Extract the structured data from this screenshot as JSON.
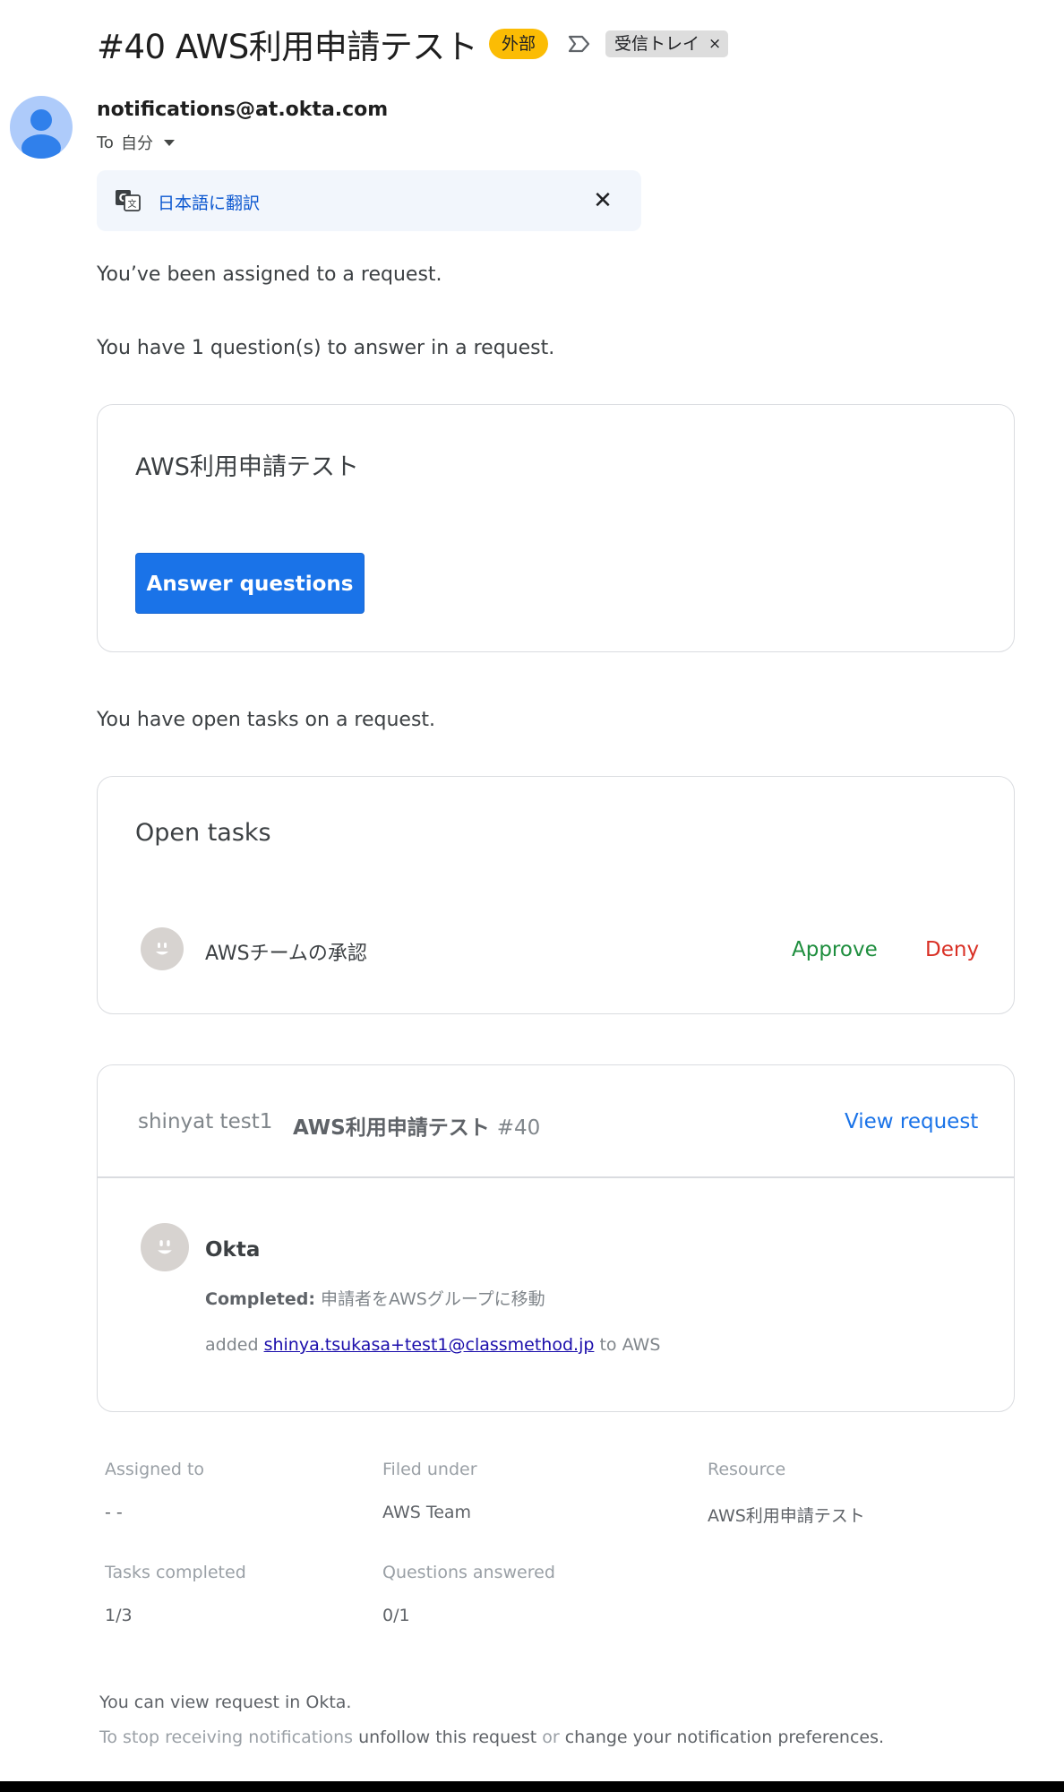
{
  "email": {
    "subject": "#40 AWS利用申請テスト",
    "external_badge": "外部",
    "inbox_label": "受信トレイ",
    "inbox_label_remove": "×",
    "sender": "notifications@at.okta.com",
    "to_prefix": "To",
    "to_value": "自分",
    "translate_link": "日本語に翻訳",
    "translate_close": "✕"
  },
  "body": {
    "assigned_text": "You’ve been assigned to a request.",
    "questions_text": "You have 1 question(s) to answer in a request.",
    "open_tasks_text": "You have open tasks on a request."
  },
  "question_card": {
    "title": "AWS利用申請テスト",
    "button_label": "Answer questions"
  },
  "tasks_card": {
    "title": "Open tasks",
    "task_name": "AWSチームの承認",
    "approve_label": "Approve",
    "deny_label": "Deny"
  },
  "request_card": {
    "requester": "shinyat test1",
    "request_title": "AWS利用申請テスト",
    "request_number": "#40",
    "view_label": "View request",
    "actor": "Okta",
    "completed_label": "Completed:",
    "completed_value": "申請者をAWSグループに移動",
    "added_prefix": "added",
    "added_email": "shinya.tsukasa+test1@classmethod.jp",
    "added_suffix": "to AWS"
  },
  "details": {
    "assigned_to_label": "Assigned to",
    "assigned_to_value": "- -",
    "filed_under_label": "Filed under",
    "filed_under_value": "AWS Team",
    "resource_label": "Resource",
    "resource_value": "AWS利用申請テスト",
    "tasks_completed_label": "Tasks completed",
    "tasks_completed_value": "1/3",
    "questions_answered_label": "Questions answered",
    "questions_answered_value": "0/1"
  },
  "footer": {
    "view_text": "You can view request in Okta.",
    "stop_prefix": "To stop receiving notifications",
    "unfollow_link": "unfollow this request",
    "or_text": "or",
    "preferences_link": "change your notification preferences."
  },
  "colors": {
    "external_badge": "#fbbc04",
    "primary_button": "#1a73e8",
    "approve": "#1e8e3e",
    "deny": "#d93025",
    "translate_bar": "#f2f6fc"
  },
  "icons": [
    "label-arrow-icon",
    "person-avatar-icon",
    "translate-icon",
    "close-icon",
    "smiley-avatar-icon"
  ]
}
